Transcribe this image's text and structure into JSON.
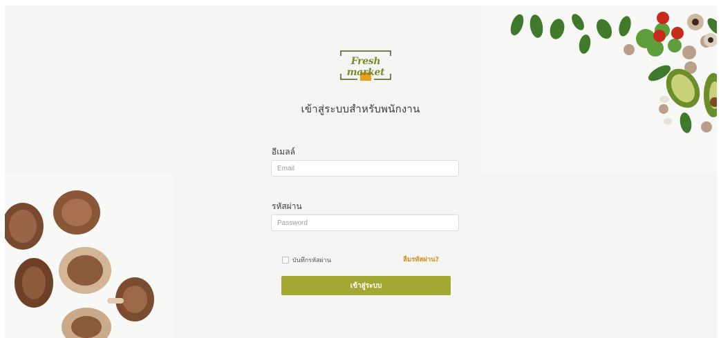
{
  "brand": {
    "logo_text": "Fresh market",
    "accent_color": "#a3a833",
    "link_color": "#d88c1e"
  },
  "page_title": "เข้าสู่ระบบสำหรับพนักงาน",
  "form": {
    "email_label": "อีเมลล์",
    "email_placeholder": "Email",
    "password_label": "รหัสผ่าน",
    "password_placeholder": "Password",
    "remember_label": "บันทึกรหัสผ่าน",
    "forgot_link": "ลืมรหัสผ่าน?",
    "submit_label": "เข้าสู่ระบบ"
  },
  "images": {
    "vegetables": "vegetables-and-spinach-image",
    "mushrooms": "shiitake-mushrooms-image"
  }
}
